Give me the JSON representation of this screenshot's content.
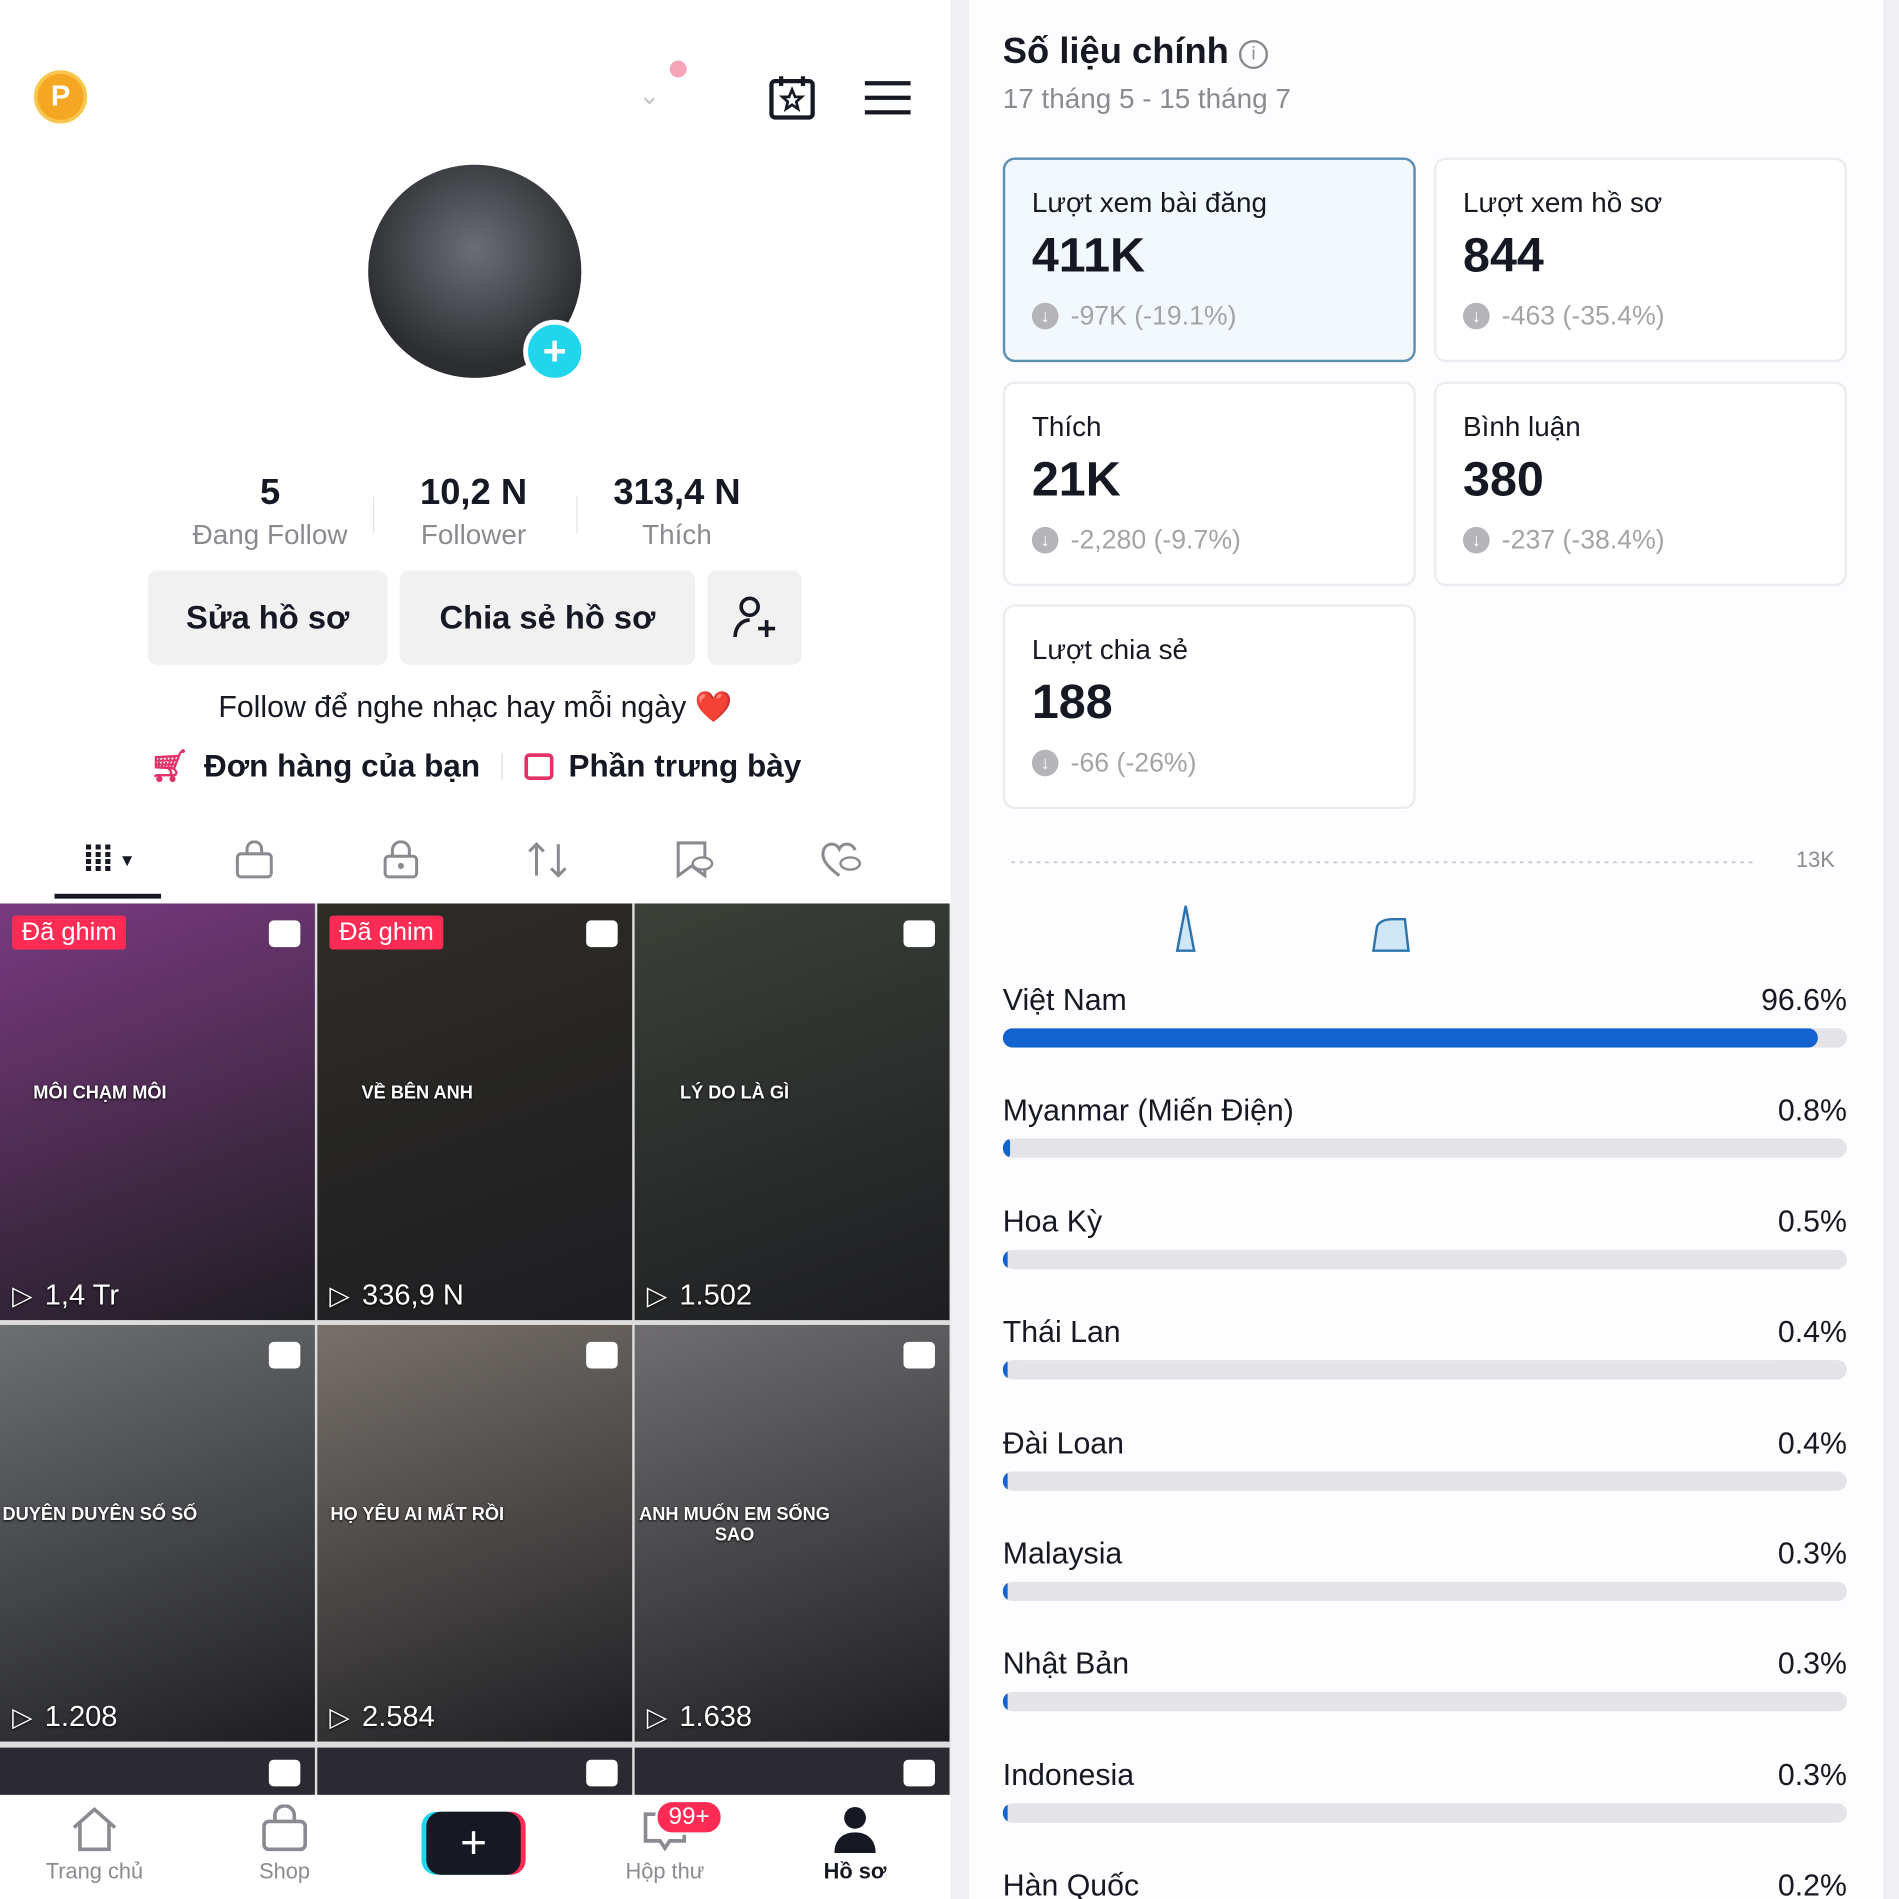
{
  "profile": {
    "coin_label": "P",
    "stats": [
      {
        "value": "5",
        "label": "Đang Follow"
      },
      {
        "value": "10,2 N",
        "label": "Follower"
      },
      {
        "value": "313,4 N",
        "label": "Thích"
      }
    ],
    "edit_label": "Sửa hồ sơ",
    "share_label": "Chia sẻ hồ sơ",
    "bio": "Follow để nghe nhạc hay mỗi ngày ❤️",
    "orders_label": "Đơn hàng của bạn",
    "showcase_label": "Phần trưng bày"
  },
  "tabs": [
    "grid-icon",
    "shop-bag-icon",
    "lock-icon",
    "repost-icon",
    "bookmark-hidden-icon",
    "liked-hidden-icon"
  ],
  "videos": [
    {
      "pinned": "Đã ghim",
      "title": "MÔI CHẠM MÔI",
      "views": "1,4 Tr",
      "bg": "#7a3a80"
    },
    {
      "pinned": "Đã ghim",
      "title": "VỀ BÊN ANH",
      "views": "336,9 N",
      "bg": "#2e2c26"
    },
    {
      "pinned": "",
      "title": "LÝ DO LÀ GÌ",
      "views": "1.502",
      "bg": "#3a4038"
    },
    {
      "pinned": "",
      "title": "DUYÊN DUYÊN SỐ SỐ",
      "views": "1.208",
      "bg": "#6c6f72"
    },
    {
      "pinned": "",
      "title": "HỌ YÊU AI MẤT RỒI",
      "views": "2.584",
      "bg": "#77716b"
    },
    {
      "pinned": "",
      "title": "ANH MUỐN EM SỐNG SAO",
      "views": "1.638",
      "bg": "#6f6d70"
    }
  ],
  "nav": {
    "home": "Trang chủ",
    "shop": "Shop",
    "inbox": "Hộp thư",
    "inbox_badge": "99+",
    "profile": "Hồ sơ"
  },
  "metrics": {
    "title": "Số liệu chính",
    "range": "17 tháng 5 - 15 tháng 7",
    "cards": [
      {
        "label": "Lượt xem bài đăng",
        "value": "411K",
        "delta": "-97K (-19.1%)"
      },
      {
        "label": "Lượt xem hồ sơ",
        "value": "844",
        "delta": "-463 (-35.4%)"
      },
      {
        "label": "Thích",
        "value": "21K",
        "delta": "-2,280 (-9.7%)"
      },
      {
        "label": "Bình luận",
        "value": "380",
        "delta": "-237 (-38.4%)"
      },
      {
        "label": "Lượt chia sẻ",
        "value": "188",
        "delta": "-66 (-26%)"
      }
    ],
    "chart_max_label": "13K"
  },
  "countries": [
    {
      "name": "Việt Nam",
      "pct": "96.6%",
      "value": 96.6
    },
    {
      "name": "Myanmar (Miến Điện)",
      "pct": "0.8%",
      "value": 0.8
    },
    {
      "name": "Hoa Kỳ",
      "pct": "0.5%",
      "value": 0.5
    },
    {
      "name": "Thái Lan",
      "pct": "0.4%",
      "value": 0.4
    },
    {
      "name": "Đài Loan",
      "pct": "0.4%",
      "value": 0.4
    },
    {
      "name": "Malaysia",
      "pct": "0.3%",
      "value": 0.3
    },
    {
      "name": "Nhật Bản",
      "pct": "0.3%",
      "value": 0.3
    },
    {
      "name": "Indonesia",
      "pct": "0.3%",
      "value": 0.3
    },
    {
      "name": "Hàn Quốc",
      "pct": "0.2%",
      "value": 0.2
    }
  ],
  "colors": {
    "accent": "#fe2c55",
    "bar": "#1263d0",
    "teal": "#20d5ec"
  }
}
